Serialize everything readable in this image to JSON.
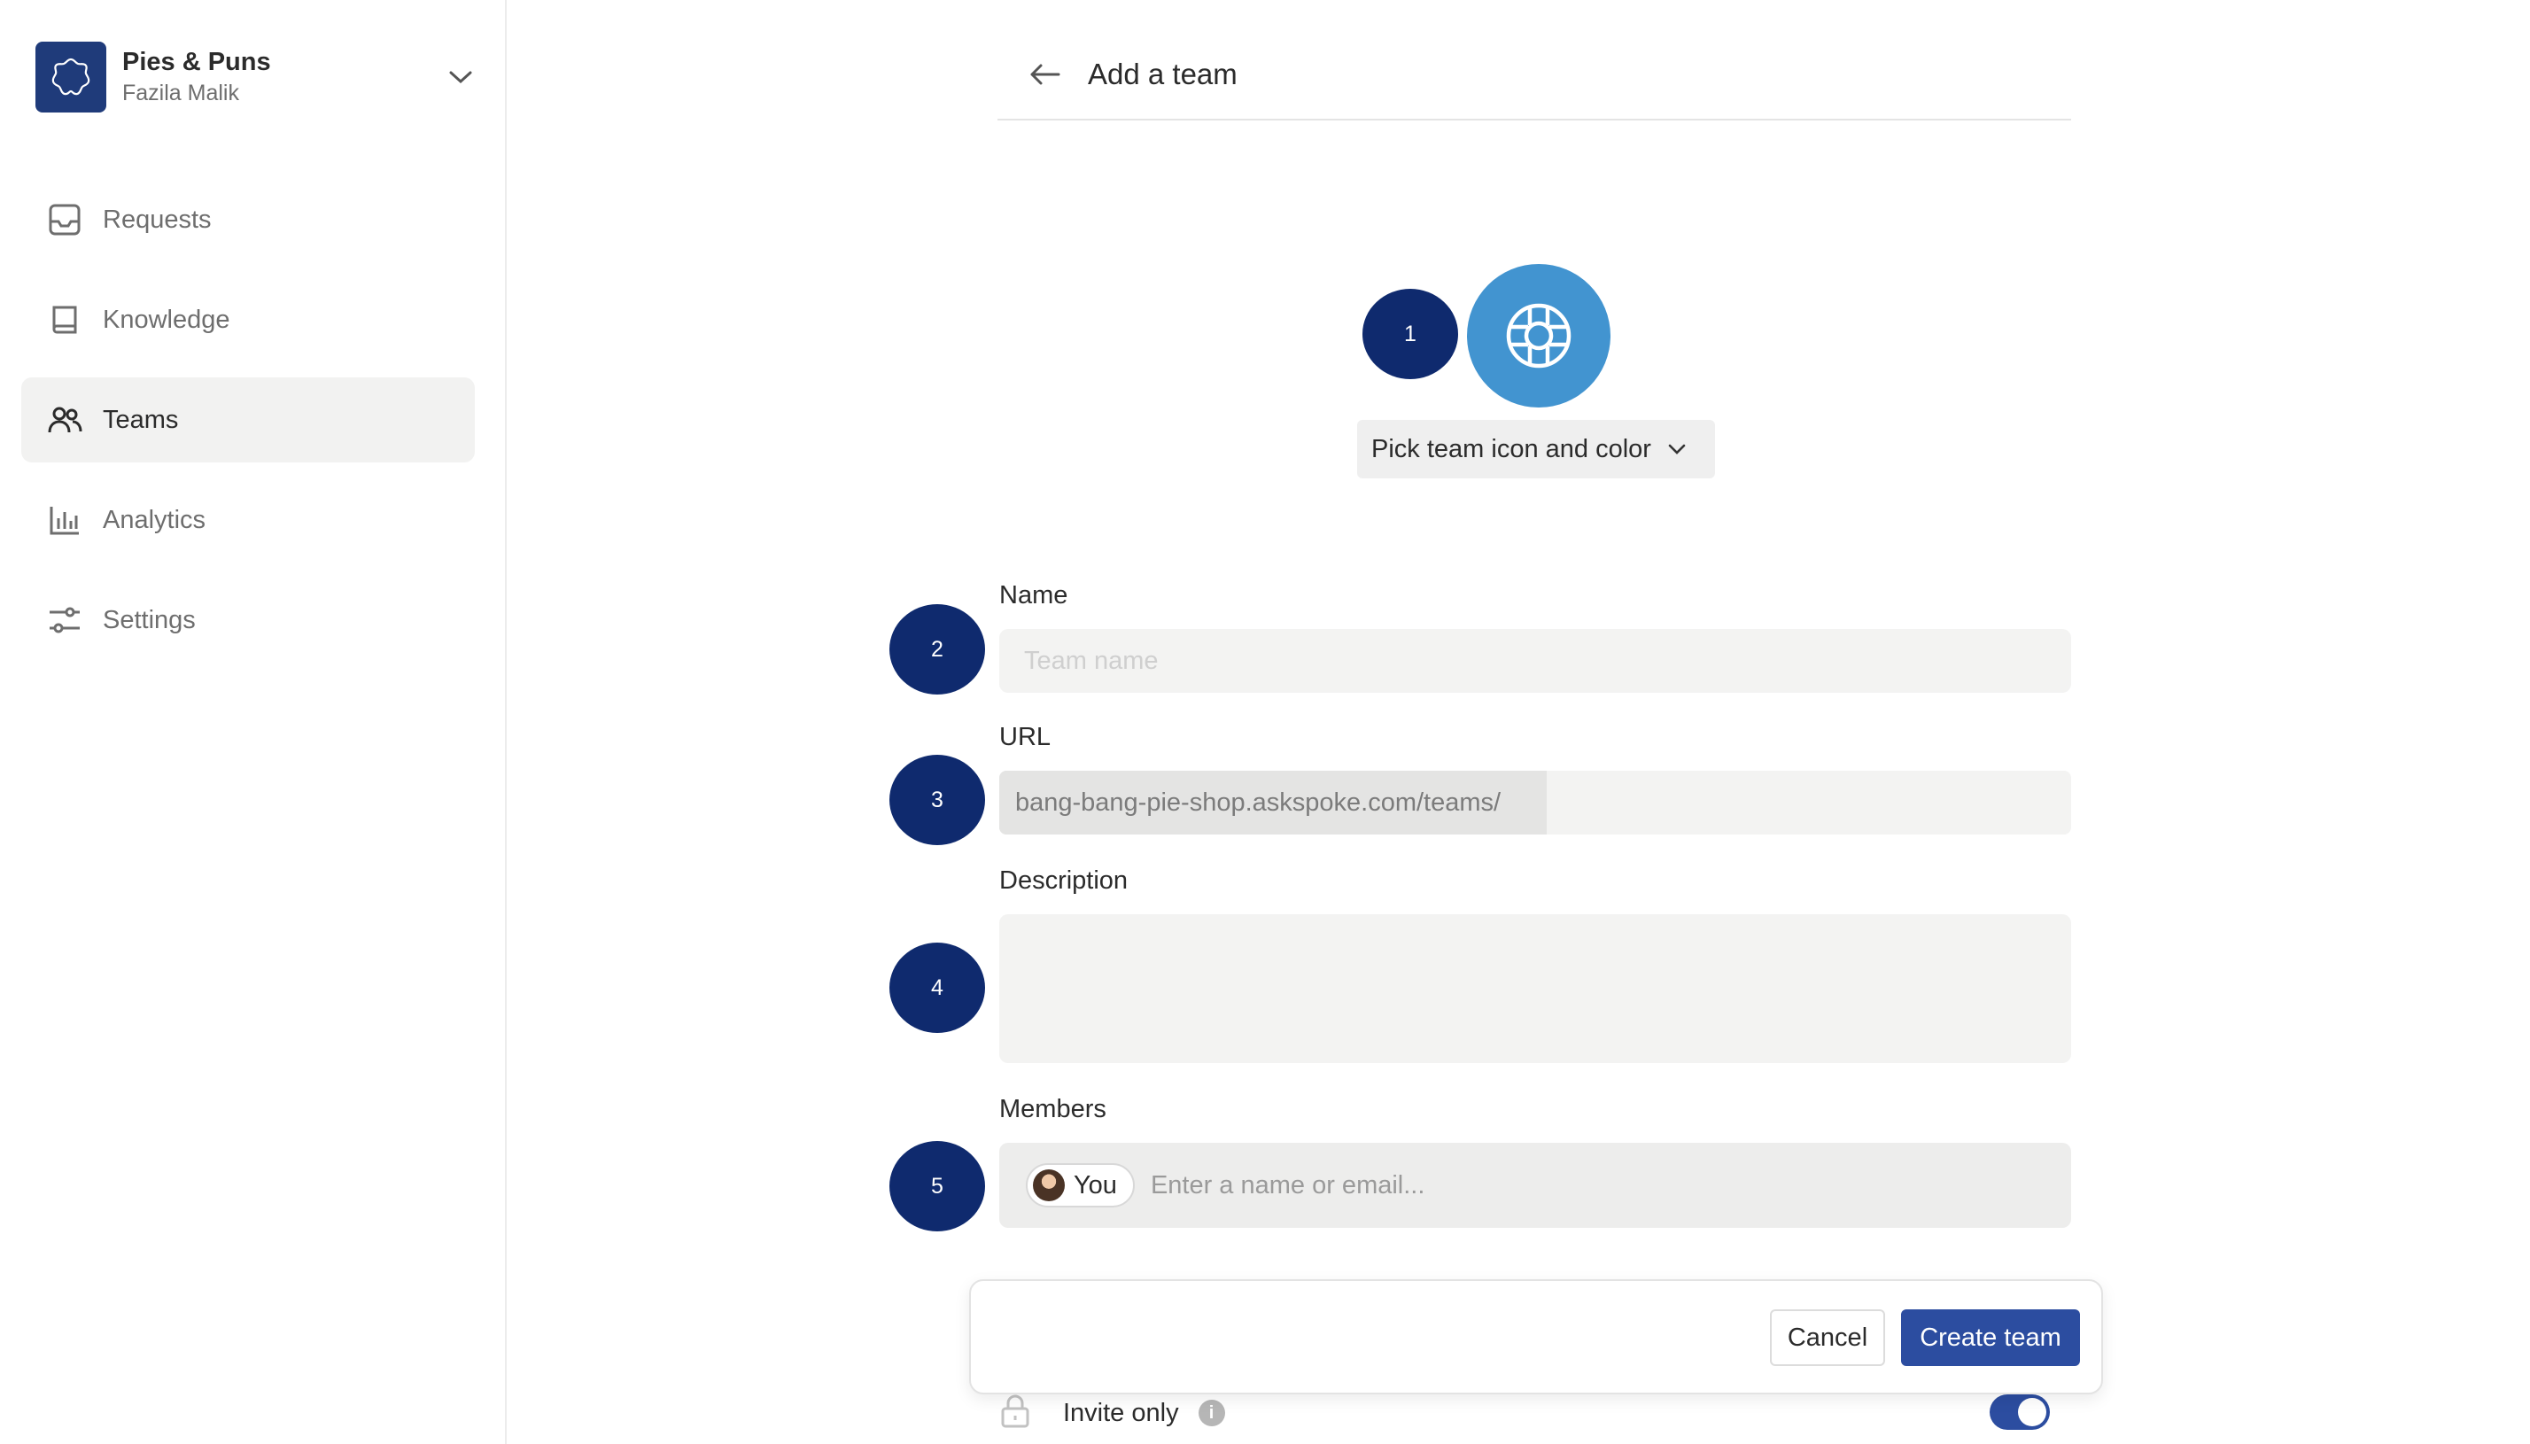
{
  "workspace": {
    "name": "Pies & Puns",
    "user": "Fazila Malik",
    "logo_icon": "flower-logo-icon",
    "chevron_icon": "chevron-down-icon"
  },
  "sidebar": {
    "items": [
      {
        "label": "Requests",
        "icon": "inbox-icon",
        "active": false
      },
      {
        "label": "Knowledge",
        "icon": "book-icon",
        "active": false
      },
      {
        "label": "Teams",
        "icon": "users-icon",
        "active": true
      },
      {
        "label": "Analytics",
        "icon": "bar-chart-icon",
        "active": false
      },
      {
        "label": "Settings",
        "icon": "sliders-icon",
        "active": false
      }
    ]
  },
  "header": {
    "title": "Add a team",
    "back_icon": "arrow-left-icon"
  },
  "steps": [
    "1",
    "2",
    "3",
    "4",
    "5"
  ],
  "team_icon": {
    "icon": "lifebuoy-icon",
    "color": "#4294d0",
    "pick_label": "Pick team icon and color"
  },
  "form": {
    "name_label": "Name",
    "name_placeholder": "Team name",
    "url_label": "URL",
    "url_prefix": "bang-bang-pie-shop.askspoke.com/teams/",
    "description_label": "Description",
    "members_label": "Members",
    "member_chip": "You",
    "members_placeholder": "Enter a name or email...",
    "invite_label": "Invite only",
    "invite_only": true
  },
  "actions": {
    "cancel_label": "Cancel",
    "create_label": "Create team"
  },
  "colors": {
    "accent": "#2c4da0",
    "badge": "#0f2a6e",
    "team_icon_bg": "#4294d0"
  }
}
